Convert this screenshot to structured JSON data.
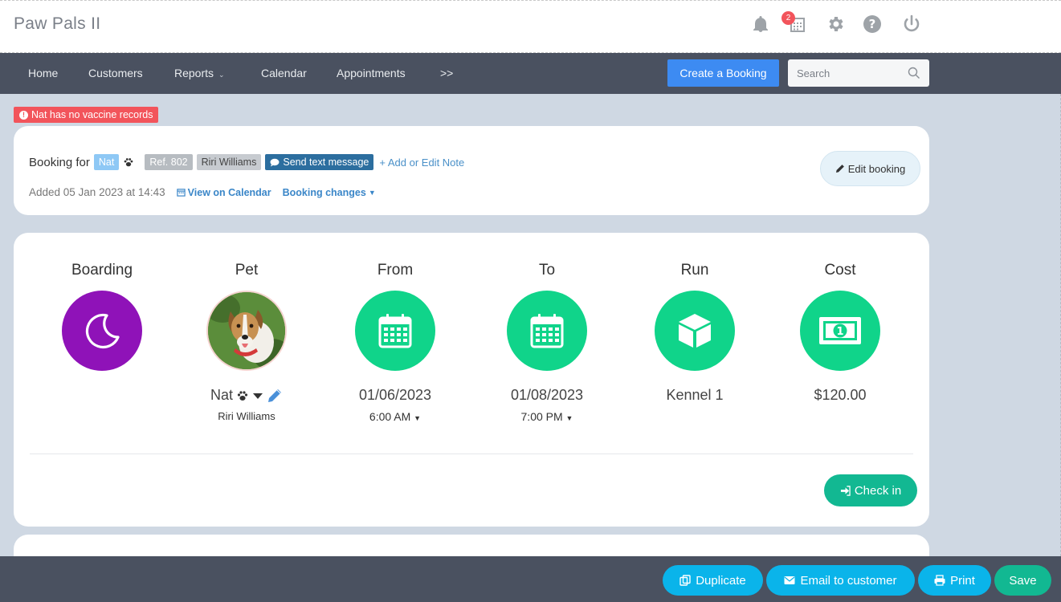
{
  "app": {
    "title": "Paw Pals II",
    "notification_count": "2"
  },
  "header_icons": [
    "bell-icon",
    "calendar-icon",
    "gear-icon",
    "help-icon",
    "power-icon"
  ],
  "nav": {
    "items": [
      {
        "label": "Home"
      },
      {
        "label": "Customers"
      },
      {
        "label": "Reports"
      },
      {
        "label": "Calendar"
      },
      {
        "label": "Appointments"
      },
      {
        "label": ">>"
      }
    ],
    "create_label": "Create a Booking",
    "search_placeholder": "Search"
  },
  "alert": {
    "text": "Nat has no vaccine records"
  },
  "booking": {
    "label": "Booking for",
    "pet": "Nat",
    "ref": "Ref. 802",
    "owner": "Riri Williams",
    "sms_label": "Send text message",
    "note_link": "+ Add or Edit Note",
    "added": "Added 05 Jan 2023 at 14:43",
    "view_calendar": "View on Calendar",
    "changes": "Booking changes",
    "edit_label": "Edit booking"
  },
  "details": {
    "service": {
      "title": "Boarding"
    },
    "pet": {
      "title": "Pet",
      "name": "Nat",
      "owner": "Riri Williams"
    },
    "from": {
      "title": "From",
      "date": "01/06/2023",
      "time": "6:00 AM"
    },
    "to": {
      "title": "To",
      "date": "01/08/2023",
      "time": "7:00 PM"
    },
    "run": {
      "title": "Run",
      "value": "Kennel 1"
    },
    "cost": {
      "title": "Cost",
      "value": "$120.00"
    },
    "checkin_label": "Check in"
  },
  "colors": {
    "green": "#10d48a",
    "purple": "#8f12b8",
    "nav": "#4a5160",
    "primary": "#3d8bf2",
    "alert": "#f2545b"
  },
  "footer": {
    "duplicate": "Duplicate",
    "email": "Email to customer",
    "print": "Print",
    "save": "Save"
  }
}
